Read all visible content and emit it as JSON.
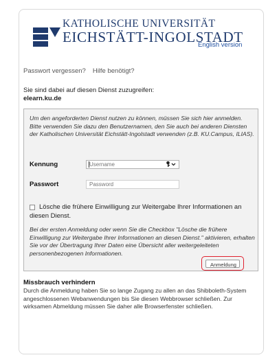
{
  "header": {
    "university_line1": "KATHOLISCHE UNIVERSITÄT",
    "university_line2": "EICHSTÄTT-INGOLSTADT",
    "english_link": "English version"
  },
  "help_links": {
    "forgot_password": "Passwort vergessen?",
    "need_help": "Hilfe benötigt?"
  },
  "intro": {
    "text": "Sie sind dabei auf diesen Dienst zuzugreifen:",
    "service": "elearn.ku.de"
  },
  "login_box": {
    "instructions": "Um den angeforderten Dienst nutzen zu können, müssen Sie sich hier anmelden. Bitte verwenden Sie dazu den Benutzernamen, den Sie auch bei anderen Diensten der Katholischen Universität Eichstätt-Ingolstadt verwenden (z.B. KU.Campus, ILIAS).",
    "username_label": "Kennung",
    "username_placeholder": "Username",
    "password_label": "Passwort",
    "password_placeholder": "Password",
    "checkbox_label": "Lösche die frühere Einwilligung zur Weitergabe Ihrer Informationen an diesen Dienst.",
    "consent_note": "Bei der ersten Anmeldung oder wenn Sie die Checkbox \"Lösche die frühere Einwilligung zur Weitergabe Ihrer Informationen an diesen Dienst.\" aktivieren, erhalten Sie vor der Übertragung Ihrer Daten eine Übersicht aller weitergeleiteten personenbezogenen Informationen.",
    "submit_label": "Anmeldung"
  },
  "misuse": {
    "title": "Missbrauch verhindern",
    "text": "Durch die Anmeldung haben Sie so lange Zugang zu allen an das Shibboleth-System angeschlossenen Webanwendungen bis Sie diesen Webbrowser schließen. Zur wirksamen Abmeldung müssen Sie daher alle Browserfenster schließen."
  },
  "colors": {
    "brand_blue": "#1f3a6d",
    "link_blue": "#1f4fa0",
    "highlight_red": "#e0202e"
  },
  "icons": {
    "logo": "university-logo",
    "password_manager": "key-dropdown-icon"
  }
}
